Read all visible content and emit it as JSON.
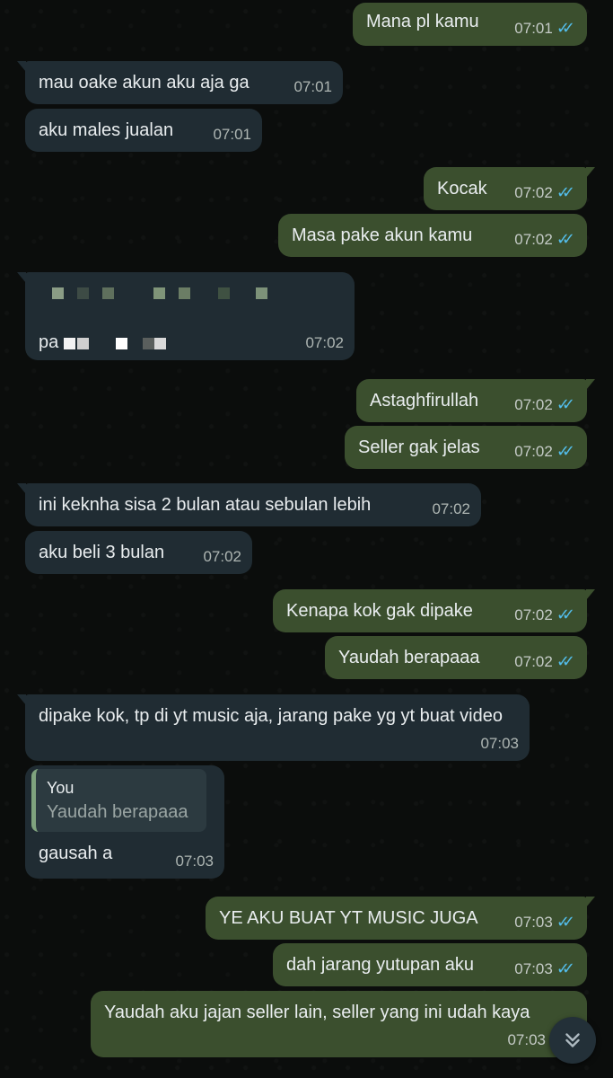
{
  "messages": [
    {
      "dir": "out",
      "text": "Mana pl kamu",
      "time": "07:01",
      "status": "read"
    },
    {
      "dir": "in",
      "text": "mau oake akun aku aja ga",
      "time": "07:01"
    },
    {
      "dir": "in",
      "text": "aku males jualan",
      "time": "07:01"
    },
    {
      "dir": "out",
      "text": "Kocak",
      "time": "07:02",
      "status": "read"
    },
    {
      "dir": "out",
      "text": "Masa pake akun kamu",
      "time": "07:02",
      "status": "read"
    },
    {
      "dir": "in",
      "text": "pa",
      "time": "07:02",
      "redacted": true
    },
    {
      "dir": "out",
      "text": "Astaghfirullah",
      "time": "07:02",
      "status": "read"
    },
    {
      "dir": "out",
      "text": "Seller gak jelas",
      "time": "07:02",
      "status": "read"
    },
    {
      "dir": "in",
      "text": "ini keknha sisa 2 bulan atau sebulan lebih",
      "time": "07:02"
    },
    {
      "dir": "in",
      "text": "aku beli 3 bulan",
      "time": "07:02"
    },
    {
      "dir": "out",
      "text": "Kenapa kok gak dipake",
      "time": "07:02",
      "status": "read"
    },
    {
      "dir": "out",
      "text": "Yaudah berapaaa",
      "time": "07:02",
      "status": "read"
    },
    {
      "dir": "in",
      "text": "dipake kok, tp di yt music aja, jarang pake yg yt buat video",
      "time": "07:03"
    },
    {
      "dir": "in",
      "text": "gausah a",
      "time": "07:03",
      "quote": {
        "author": "You",
        "text": "Yaudah berapaaa"
      }
    },
    {
      "dir": "out",
      "text": "YE AKU BUAT YT MUSIC JUGA",
      "time": "07:03",
      "status": "read"
    },
    {
      "dir": "out",
      "text": "dah jarang yutupan aku",
      "time": "07:03",
      "status": "read"
    },
    {
      "dir": "out",
      "text": "Yaudah aku jajan seller lain, seller yang ini udah kaya",
      "time": "07:03"
    }
  ],
  "icons": {
    "read_receipt": "double-check-icon",
    "scroll_down": "double-chevron-down-icon"
  },
  "colors": {
    "incoming_bubble": "#202c33",
    "outgoing_bubble": "#3b4f2e",
    "read_tick": "#53bdeb",
    "background": "#0b0d0c"
  }
}
